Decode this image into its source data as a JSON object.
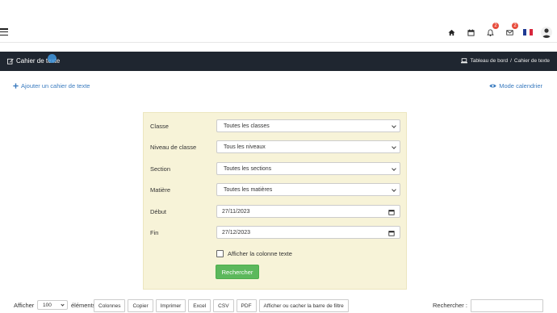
{
  "topbar": {
    "notifications_count": "2",
    "messages_count": "2"
  },
  "header": {
    "title": "Cahier de texte",
    "breadcrumb": {
      "home": "Tableau de bord",
      "separator": "/",
      "current": "Cahier de texte"
    }
  },
  "actions": {
    "add": "Ajouter un cahier de texte",
    "calendar": "Mode calendrier"
  },
  "filters": {
    "classe": {
      "label": "Classe",
      "value": "Toutes les classes"
    },
    "niveau": {
      "label": "Niveau de classe",
      "value": "Tous les niveaux"
    },
    "section": {
      "label": "Section",
      "value": "Toutes les sections"
    },
    "matiere": {
      "label": "Matière",
      "value": "Toutes les matières"
    },
    "debut": {
      "label": "Début",
      "value": "27/11/2023"
    },
    "fin": {
      "label": "Fin",
      "value": "27/12/2023"
    },
    "show_text_column": "Afficher la colonne texte",
    "search_button": "Rechercher"
  },
  "table_tools": {
    "show_label": "Afficher",
    "page_size": "100",
    "elements_label": "éléments",
    "buttons": [
      "Colonnes",
      "Copier",
      "Imprimer",
      "Excel",
      "CSV",
      "PDF",
      "Afficher ou cacher la barre de filtre"
    ],
    "search_label": "Rechercher :"
  },
  "colors": {
    "header_bg": "#1f2630",
    "link": "#3a7bbf",
    "panel_bg": "#f7f3d8",
    "primary_green": "#5cb85c",
    "badge_red": "#e74c3c"
  }
}
